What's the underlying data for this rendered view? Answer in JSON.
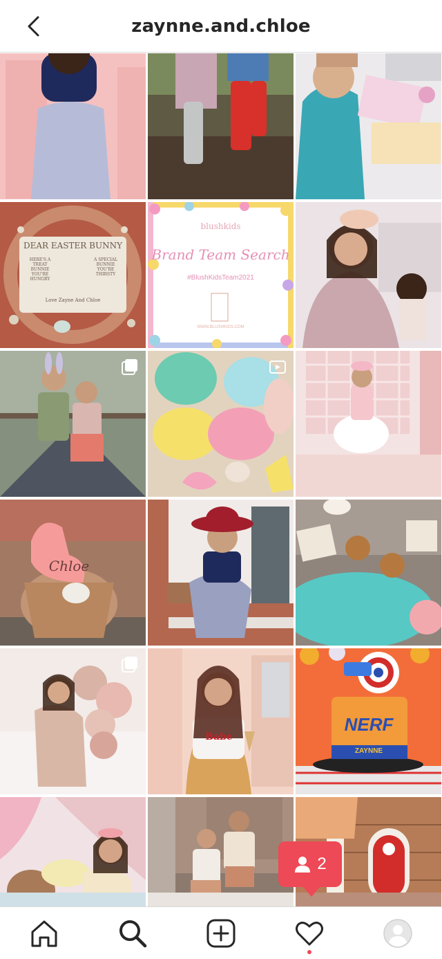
{
  "header": {
    "title": "zaynne.and.chloe",
    "back_icon": "chevron-left-icon"
  },
  "grid": {
    "tiles": [
      {
        "label": "girl-navy-top-pink-wall",
        "bg": "#f2b9b8",
        "accent": "#1f2a5c"
      },
      {
        "label": "rain-boots-puddle",
        "bg": "#6e6a4f",
        "accent": "#d8302a"
      },
      {
        "label": "girl-crafting-scissors",
        "bg": "#e9e7ea",
        "accent": "#3aa7b5"
      },
      {
        "label": "easter-wreath-sign",
        "bg": "#b85c47",
        "accent": "#eae3d6"
      },
      {
        "label": "brand-team-search-graphic",
        "bg": "#ffffff",
        "accent": "#e58fb5"
      },
      {
        "label": "girl-bow-with-doll",
        "bg": "#e8dfe1",
        "accent": "#c9a7ad"
      },
      {
        "label": "kids-bunny-ears-bridge",
        "bg": "#6d7a6a",
        "accent": "#e6b4a6",
        "icon": "multi-photo-icon"
      },
      {
        "label": "play-dough-jars",
        "bg": "#e6d8c6",
        "accent": "#f0a5b8",
        "icon": "video-icon"
      },
      {
        "label": "girl-tutu-pink-house",
        "bg": "#f2dedd",
        "accent": "#ffffff"
      },
      {
        "label": "chloe-bunny-basket",
        "bg": "#b8876d",
        "accent": "#f59c9a"
      },
      {
        "label": "girl-red-hat-window",
        "bg": "#b3674f",
        "accent": "#a21e2d"
      },
      {
        "label": "teal-dough-stamps",
        "bg": "#9a8e86",
        "accent": "#57c8c4"
      },
      {
        "label": "mom-balloons-bed",
        "bg": "#f1e9e6",
        "accent": "#e8b9b0",
        "icon": "multi-photo-icon"
      },
      {
        "label": "girl-babe-shirt-icecream",
        "bg": "#f3cfc0",
        "accent": "#d9a35c"
      },
      {
        "label": "nerf-cake",
        "bg": "#f26f3d",
        "accent": "#2b4fb0"
      },
      {
        "label": "girl-pink-canopy-bed",
        "bg": "#eedee2",
        "accent": "#f3e6c9"
      },
      {
        "label": "siblings-walking-street",
        "bg": "#8d7a6e",
        "accent": "#c98a6c"
      },
      {
        "label": "red-door-feet",
        "bg": "#a9714f",
        "accent": "#d22d2a"
      }
    ]
  },
  "tile_texts": {
    "wreath_line1": "DEAR EASTER BUNNY",
    "wreath_left": "HERE'S A TREAT BUNNIE YOU'RE HUNGRY",
    "wreath_right": "A SPECIAL BUNNIE YOU'RE THIRSTY",
    "wreath_sign": "Love Zayne And Chloe",
    "brand_logo": "blushkids",
    "brand_title": "Brand Team Search",
    "brand_tag": "#BlushKidsTeam2021",
    "brand_url": "WWW.BLUSHKIDS.COM",
    "chloe_tag": "Chloe",
    "nerf_word": "NERF",
    "nerf_name": "ZAYNNE",
    "babe_shirt": "Babe"
  },
  "notification": {
    "icon": "person-icon",
    "count": "2"
  },
  "bottom_nav": {
    "items": [
      {
        "name": "home-icon"
      },
      {
        "name": "search-icon"
      },
      {
        "name": "new-post-icon"
      },
      {
        "name": "activity-heart-icon"
      },
      {
        "name": "profile-avatar-icon"
      }
    ]
  }
}
